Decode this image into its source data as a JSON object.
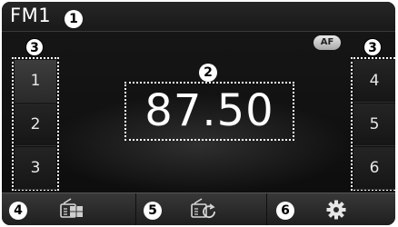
{
  "header": {
    "band": "FM1"
  },
  "badge": {
    "af": "AF"
  },
  "frequency": {
    "value": "87.50"
  },
  "presets": {
    "left": [
      {
        "label": "1"
      },
      {
        "label": "2"
      },
      {
        "label": "3"
      }
    ],
    "right": [
      {
        "label": "4"
      },
      {
        "label": "5"
      },
      {
        "label": "6"
      }
    ]
  },
  "callouts": [
    "1",
    "2",
    "3",
    "3",
    "4",
    "5",
    "6"
  ],
  "bottom_bar": {
    "buttons": [
      {
        "icon": "radio-list-icon"
      },
      {
        "icon": "radio-scan-icon"
      },
      {
        "icon": "gear-icon"
      }
    ]
  },
  "colors": {
    "background": "#111111",
    "text": "#ffffff",
    "highlight": "#ffffff"
  }
}
